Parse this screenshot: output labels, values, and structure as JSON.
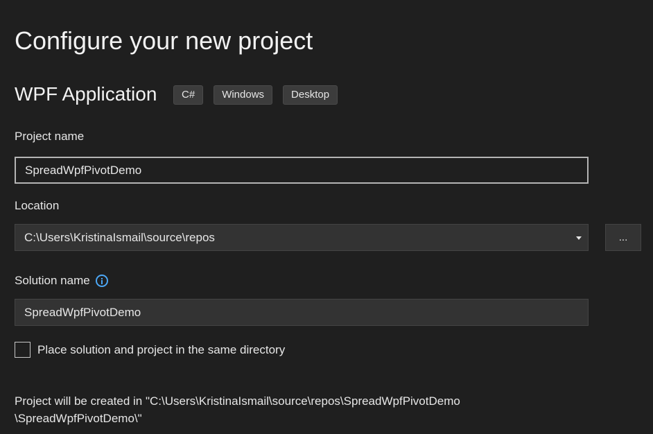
{
  "header": {
    "title": "Configure your new project"
  },
  "template": {
    "name": "WPF Application",
    "tags": [
      "C#",
      "Windows",
      "Desktop"
    ]
  },
  "project_name": {
    "label": "Project name",
    "value": "SpreadWpfPivotDemo"
  },
  "location": {
    "label": "Location",
    "value": "C:\\Users\\KristinaIsmail\\source\\repos",
    "browse_label": "..."
  },
  "solution_name": {
    "label": "Solution name",
    "info_icon": "info-icon",
    "value": "SpreadWpfPivotDemo"
  },
  "same_directory": {
    "label": "Place solution and project in the same directory",
    "checked": false
  },
  "footer": {
    "line1": "Project will be created in \"C:\\Users\\KristinaIsmail\\source\\repos\\SpreadWpfPivotDemo",
    "line2": "\\SpreadWpfPivotDemo\\\""
  },
  "colors": {
    "background": "#1f1f1f",
    "field_background": "#333333",
    "accent_info": "#4ca7f5"
  }
}
